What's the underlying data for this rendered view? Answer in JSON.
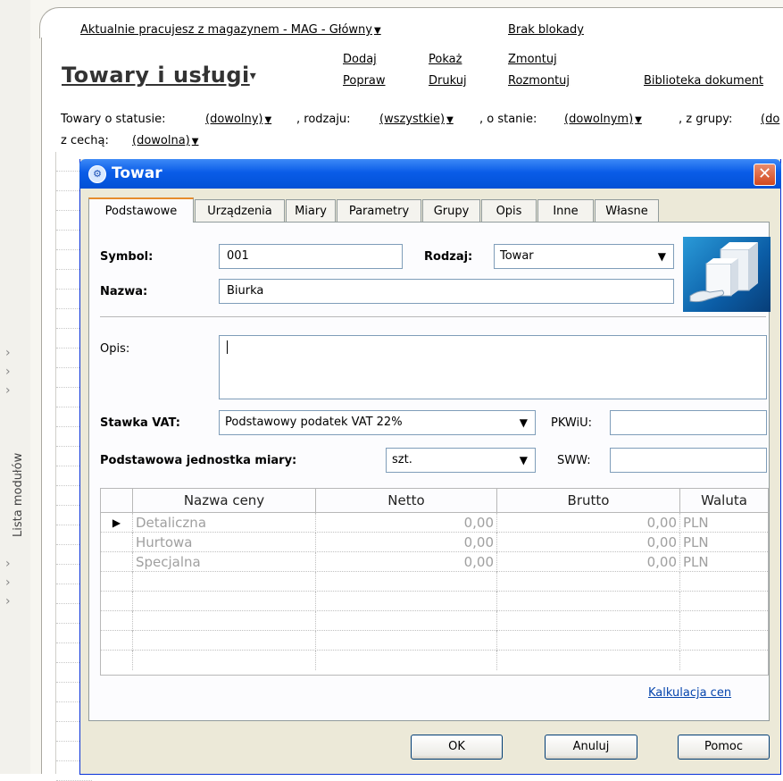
{
  "rail": {
    "label": "Lista modułów"
  },
  "topbar": {
    "warehouse_text": "Aktualnie pracujesz z magazynem - MAG - Główny",
    "lock_text": "Brak blokady"
  },
  "page": {
    "title": "Towary i usługi",
    "actions": {
      "add": "Dodaj",
      "edit": "Popraw",
      "show": "Pokaż",
      "print": "Drukuj",
      "assemble": "Zmontuj",
      "disassemble": "Rozmontuj",
      "library": "Biblioteka dokument"
    }
  },
  "filters": {
    "status_prefix": "Towary o statusie:",
    "status_value": "(dowolny)",
    "kind_prefix": ", rodzaju:",
    "kind_value": "(wszystkie)",
    "state_prefix": ", o stanie:",
    "state_value": "(dowolnym)",
    "group_prefix": ", z grupy:",
    "group_value": "(do",
    "feature_prefix": "z cechą:",
    "feature_value": "(dowolna)"
  },
  "dialog": {
    "title": "Towar",
    "close_glyph": "✕",
    "tabs": [
      "Podstawowe",
      "Urządzenia",
      "Miary",
      "Parametry",
      "Grupy",
      "Opis",
      "Inne",
      "Własne"
    ],
    "fields": {
      "symbol_label": "Symbol:",
      "symbol_value": "001",
      "kind_label": "Rodzaj:",
      "kind_value": "Towar",
      "name_label": "Nazwa:",
      "name_value": "Biurka",
      "desc_label": "Opis:",
      "desc_value": "",
      "vat_label": "Stawka VAT:",
      "vat_value": "Podstawowy podatek VAT 22%",
      "pkwiu_label": "PKWiU:",
      "pkwiu_value": "",
      "unit_label": "Podstawowa jednostka miary:",
      "unit_value": "szt.",
      "sww_label": "SWW:",
      "sww_value": ""
    },
    "price_table": {
      "headers": [
        "Nazwa ceny",
        "Netto",
        "Brutto",
        "Waluta"
      ],
      "rows": [
        {
          "name": "Detaliczna",
          "netto": "0,00",
          "brutto": "0,00",
          "currency": "PLN"
        },
        {
          "name": "Hurtowa",
          "netto": "0,00",
          "brutto": "0,00",
          "currency": "PLN"
        },
        {
          "name": "Specjalna",
          "netto": "0,00",
          "brutto": "0,00",
          "currency": "PLN"
        }
      ]
    },
    "calc_link": "Kalkulacja cen",
    "buttons": {
      "ok": "OK",
      "cancel": "Anuluj",
      "help": "Pomoc"
    }
  }
}
